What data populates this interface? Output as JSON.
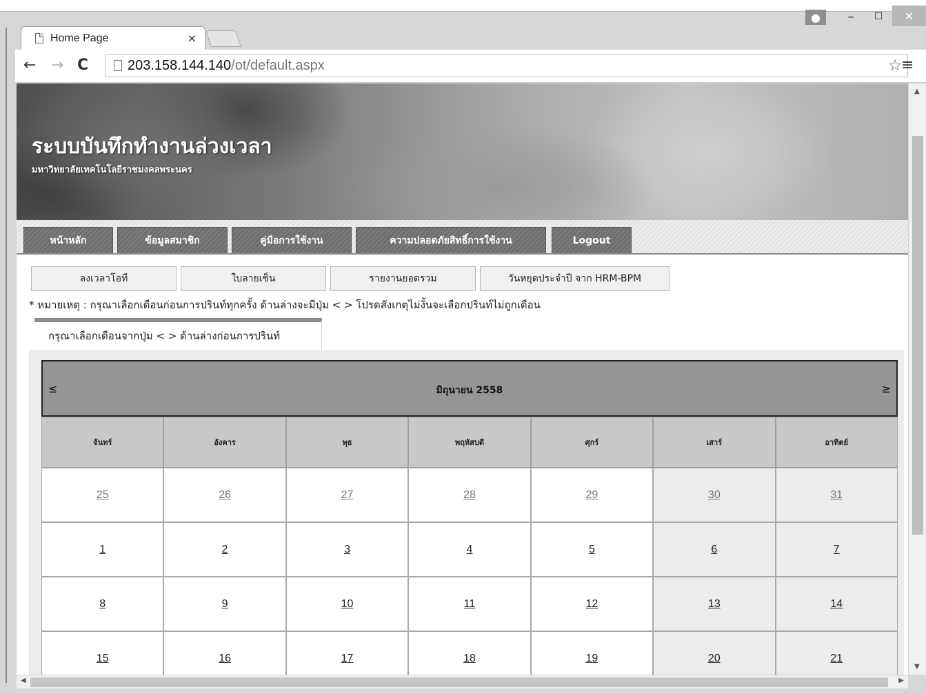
{
  "browser": {
    "tab_title": "Home Page",
    "tab_close": "×",
    "url_host": "203.158.144.140",
    "url_path": "/ot/default.aspx",
    "window_min": "–",
    "window_max": "☐",
    "window_close": "✕"
  },
  "banner": {
    "title": "ระบบบันทึกทำงานล่วงเวลา",
    "subtitle": "มหาวิทยาลัยเทคโนโลยีราชมงคลพระนคร"
  },
  "main_menu": [
    {
      "label": "หน้าหลัก"
    },
    {
      "label": "ข้อมูลสมาชิก"
    },
    {
      "label": "คู่มือการใช้งาน"
    },
    {
      "label": "ความปลอดภัยสิทธิ์การใช้งาน"
    },
    {
      "label": "Logout"
    }
  ],
  "sub_menu": [
    {
      "label": "ลงเวลาโอที"
    },
    {
      "label": "ใบลายเซ็น"
    },
    {
      "label": "รายงานยอดรวม"
    },
    {
      "label": "วันหยุดประจำปี จาก HRM-BPM"
    }
  ],
  "note": "* หมายเหตุ : กรุณาเลือกเดือนก่อนการปรินท์ทุกครั้ง ด้านล่างจะมีปุ่ม < > โปรดสังเกตุไม่งั้นจะเลือกปรินท์ไม่ถูกเดือน",
  "info_tab": "กรุณาเลือกเดือนจากปุ่ม < > ด้านล่างก่อนการปรินท์",
  "calendar": {
    "prev": "≤",
    "next": "≥",
    "month": "มิถุนายน 2558",
    "day_names": [
      "จันทร์",
      "อังคาร",
      "พุธ",
      "พฤหัสบดี",
      "ศุกร์",
      "เสาร์",
      "อาทิตย์"
    ],
    "weeks": [
      [
        "25",
        "26",
        "27",
        "28",
        "29",
        "30",
        "31"
      ],
      [
        "1",
        "2",
        "3",
        "4",
        "5",
        "6",
        "7"
      ],
      [
        "8",
        "9",
        "10",
        "11",
        "12",
        "13",
        "14"
      ],
      [
        "15",
        "16",
        "17",
        "18",
        "19",
        "20",
        "21"
      ]
    ]
  }
}
